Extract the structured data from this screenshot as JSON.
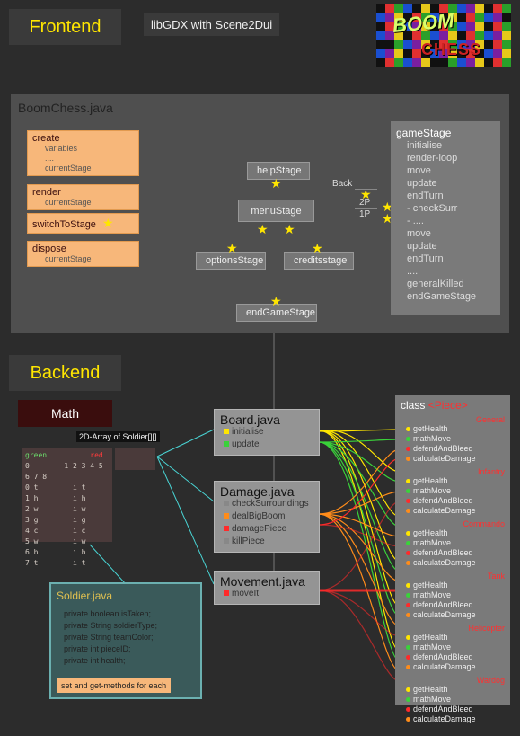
{
  "frontend_label": "Frontend",
  "backend_label": "Backend",
  "libgdx_label": "libGDX with Scene2Dui",
  "logo": {
    "line1": "BOOM",
    "line2": "CHESS"
  },
  "boomchess": {
    "title": "BoomChess.java",
    "create": {
      "label": "create",
      "subs": [
        "variables",
        "....",
        "currentStage"
      ]
    },
    "render": {
      "label": "render",
      "subs": [
        "currentStage"
      ]
    },
    "switch": {
      "label": "switchToStage",
      "subs": []
    },
    "dispose": {
      "label": "dispose",
      "subs": [
        "currentStage"
      ]
    }
  },
  "stages": {
    "helpStage": "helpStage",
    "menuStage": "menuStage",
    "optionsStage": "optionsStage",
    "creditsstage": "creditsstage",
    "endGameStage": "endGameStage"
  },
  "edge_labels": {
    "back": "Back",
    "p2": "2P",
    "p1": "1P"
  },
  "gamestage": {
    "title": "gameStage",
    "lines": [
      "initialise",
      "render-loop",
      "move",
      "update",
      "endTurn",
      " - checkSurr",
      " - ....",
      "move",
      "update",
      "endTurn",
      "....",
      "generalKilled",
      "endGameStage"
    ]
  },
  "math_label": "Math",
  "array_label": "2D-Array of Soldier[][]",
  "array_header": {
    "green": "green",
    "red": "red"
  },
  "array_rows": [
    [
      "0",
      "1 2 3 4 5 6 7 8"
    ],
    [
      "0 t",
      "i t"
    ],
    [
      "1 h",
      "i h"
    ],
    [
      "2 w",
      "i w"
    ],
    [
      "3 g",
      "i g"
    ],
    [
      "4 c",
      "i c"
    ],
    [
      "5 w",
      "i w"
    ],
    [
      "6 h",
      "i h"
    ],
    [
      "7 t",
      "i t"
    ]
  ],
  "soldier": {
    "title": "Soldier.java",
    "fields": [
      "private boolean isTaken;",
      "private String soldierType;",
      "private String teamColor;",
      "private int pieceID;",
      "private int health;"
    ],
    "methods": "set and get-methods for each"
  },
  "board": {
    "title": "Board.java",
    "methods": [
      "initialise",
      "update"
    ]
  },
  "damage": {
    "title": "Damage.java",
    "methods": [
      "checkSurroundings",
      "dealBigBoom",
      "damagePiece",
      "killPiece"
    ]
  },
  "movement": {
    "title": "Movement.java",
    "methods": [
      "moveIt"
    ]
  },
  "piece": {
    "title_class": "class ",
    "title_name": "<Piece>",
    "types": [
      "General",
      "Infantry",
      "Commando",
      "Tank",
      "Helicopter",
      "Wardog"
    ],
    "methods": [
      "getHealth",
      "mathMove",
      "defendAndBleed",
      "calculateDamage"
    ]
  },
  "colors": {
    "cyan": "#49d4d4",
    "yellow": "#ffe600",
    "green": "#3ad23a",
    "orange": "#ff8c1a",
    "red": "#ff2a2a"
  }
}
